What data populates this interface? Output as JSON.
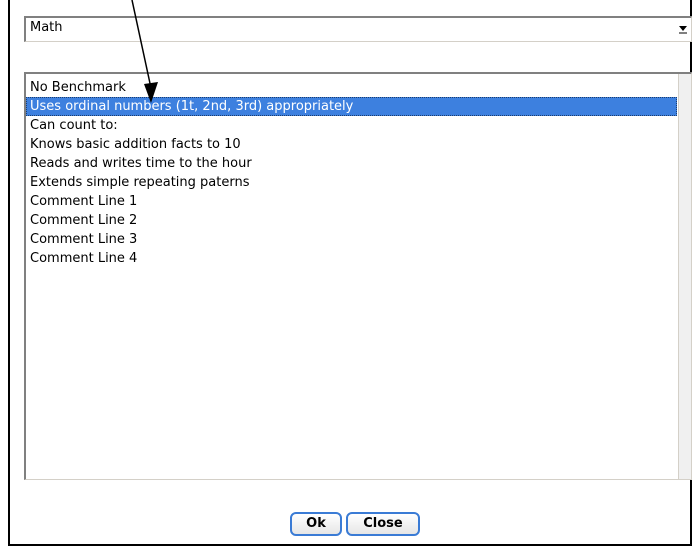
{
  "subject_dropdown": {
    "selected": "Math",
    "icon": "chevron-down-icon"
  },
  "benchmark_list": {
    "items": [
      "No Benchmark",
      "Uses ordinal numbers (1t, 2nd, 3rd) appropriately",
      "Can count to:",
      "Knows basic addition facts to 10",
      "Reads and writes time to the hour",
      "Extends simple repeating paterns",
      "Comment Line 1",
      "Comment Line 2",
      "Comment Line 3",
      "Comment Line 4"
    ],
    "selected_index": 1,
    "selected_color": "#3d80df"
  },
  "buttons": {
    "ok_label": "Ok",
    "close_label": "Close",
    "accent_color": "#3a7bd5"
  },
  "annotation": {
    "icon": "pointer-arrow-icon"
  }
}
